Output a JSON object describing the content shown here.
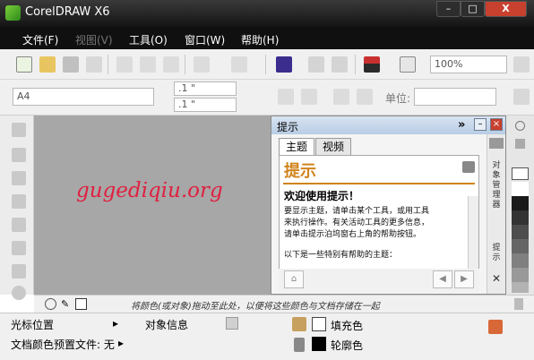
{
  "window": {
    "title": "CorelDRAW X6",
    "controls": {
      "minimize": "–",
      "maximize": "□",
      "close": "X"
    }
  },
  "menu": [
    {
      "label": "文件(F)",
      "enabled": true
    },
    {
      "label": "视图(V)",
      "enabled": false
    },
    {
      "label": "工具(O)",
      "enabled": true
    },
    {
      "label": "窗口(W)",
      "enabled": true
    },
    {
      "label": "帮助(H)",
      "enabled": true
    }
  ],
  "toolbar": {
    "zoom": "100%"
  },
  "property_bar": {
    "page_size": "A4",
    "width": ".1 \"",
    "height": ".1 \"",
    "unit_label": "单位:"
  },
  "canvas": {
    "watermark": "gugediqiu.org"
  },
  "docker": {
    "title": "提示",
    "tabs": [
      "主题",
      "视频"
    ],
    "header": "提示",
    "welcome": "欢迎使用提示！",
    "body_lines": [
      "要显示主题，请单击某个工具，或用工具",
      "来执行操作。有关活动工具的更多信息，",
      "请单击提示泊坞窗右上角的帮助按钮。"
    ],
    "subheading": "以下是一些特别有帮助的主题：",
    "side_tabs": [
      "对象管理器",
      "提示"
    ]
  },
  "palette": {
    "hint": "将颜色(或对象)拖动至此处，以便将这些颜色与文档存储在一起",
    "swatches": [
      "#ffffff",
      "#1a1a1a",
      "#333333",
      "#4d4d4d",
      "#666666",
      "#808080",
      "#999999",
      "#b3b3b3"
    ]
  },
  "status": {
    "cursor": "光标位置",
    "object_info": "对象信息",
    "doc_profile": "文档颜色预置文件: 无",
    "fill": "填充色",
    "outline": "轮廓色"
  }
}
